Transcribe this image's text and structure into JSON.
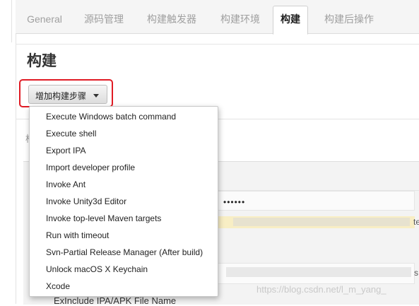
{
  "tabs": [
    {
      "label": "General",
      "active": false
    },
    {
      "label": "源码管理",
      "active": false
    },
    {
      "label": "构建触发器",
      "active": false
    },
    {
      "label": "构建环境",
      "active": false
    },
    {
      "label": "构建",
      "active": true
    },
    {
      "label": "构建后操作",
      "active": false
    }
  ],
  "section": {
    "title": "构建"
  },
  "add_step_button": {
    "label": "增加构建步骤",
    "highlight_color": "#e01b24"
  },
  "dropdown": {
    "items": [
      "Execute Windows batch command",
      "Execute shell",
      "Export IPA",
      "Import developer profile",
      "Invoke Ant",
      "Invoke Unity3d Editor",
      "Invoke top-level Maven targets",
      "Run with timeout",
      "Svn-Partial Release Manager (After build)",
      "Unlock macOS X Keychain",
      "Xcode"
    ]
  },
  "background": {
    "partial_label": "构",
    "masked_password": "••••••",
    "partial_right_1": "te",
    "partial_right_2": "s",
    "bottom_label": "ExInclude IPA/APK File Name"
  },
  "watermark": "https://blog.csdn.net/l_m_yang_"
}
